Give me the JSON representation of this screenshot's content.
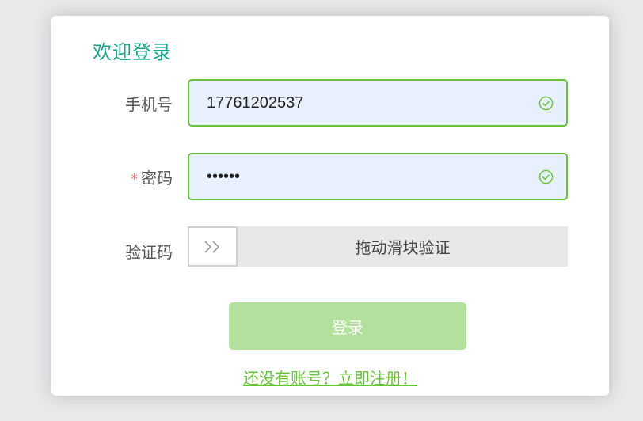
{
  "form": {
    "title": "欢迎登录",
    "phone": {
      "label": "手机号",
      "value": "17761202537",
      "valid_icon": "check-circle-icon"
    },
    "password": {
      "required_mark": "*",
      "label": "密码",
      "value": "123456",
      "valid_icon": "check-circle-icon"
    },
    "captcha": {
      "label": "验证码",
      "handle_icon": "double-chevron-right-icon",
      "slider_text": "拖动滑块验证"
    },
    "login_button": "登录",
    "register_link": "还没有账号？立即注册！"
  },
  "colors": {
    "title": "#1aa58a",
    "valid_border": "#67c23a",
    "button_disabled": "#b3e19d",
    "required_star": "#f56c6c",
    "link": "#67c23a"
  }
}
